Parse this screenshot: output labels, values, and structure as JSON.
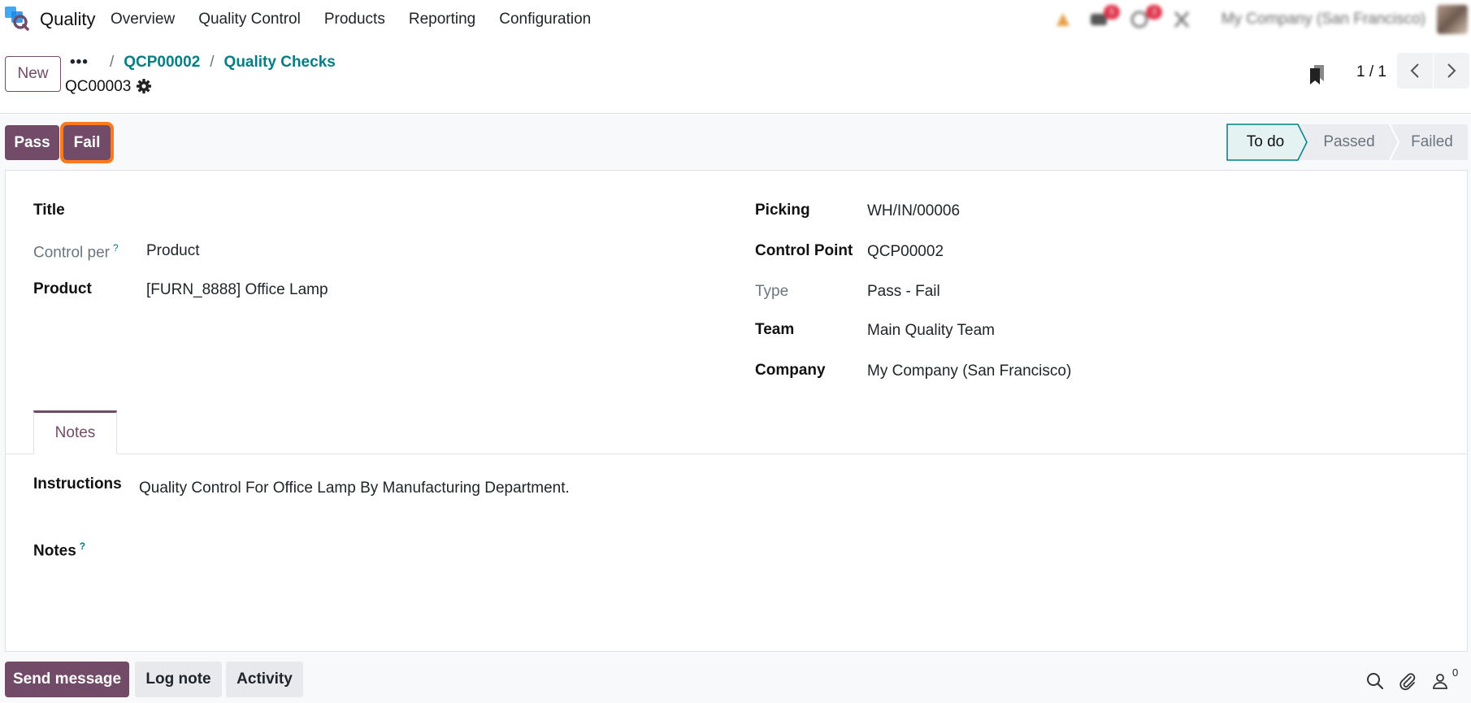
{
  "navbar": {
    "app_name": "Quality",
    "menu": [
      "Overview",
      "Quality Control",
      "Products",
      "Reporting",
      "Configuration"
    ],
    "company": "My Company (San Francisco)",
    "messages_badge": "5",
    "activities_badge": "3"
  },
  "control": {
    "new_label": "New",
    "breadcrumb": [
      "QCP00002",
      "Quality Checks"
    ],
    "record_name": "QC00003",
    "pager": "1 / 1"
  },
  "actions": {
    "pass_label": "Pass",
    "fail_label": "Fail"
  },
  "status": {
    "stages": [
      "To do",
      "Passed",
      "Failed"
    ],
    "current": "To do"
  },
  "form": {
    "left": {
      "title_label": "Title",
      "control_per_label": "Control per",
      "control_per_value": "Product",
      "product_label": "Product",
      "product_value": "[FURN_8888] Office Lamp"
    },
    "right": {
      "picking_label": "Picking",
      "picking_value": "WH/IN/00006",
      "control_point_label": "Control Point",
      "control_point_value": "QCP00002",
      "type_label": "Type",
      "type_value": "Pass - Fail",
      "team_label": "Team",
      "team_value": "Main Quality Team",
      "company_label": "Company",
      "company_value": "My Company (San Francisco)"
    },
    "tab_label": "Notes",
    "instructions_label": "Instructions",
    "instructions_value": "Quality Control For Office Lamp By Manufacturing Department.",
    "notes_label": "Notes",
    "help_mark": "?"
  },
  "chatter": {
    "send_message": "Send message",
    "log_note": "Log note",
    "activity": "Activity",
    "followers_count": "0"
  },
  "colors": {
    "brand": "#714b67",
    "link": "#017e84",
    "highlight": "#ff7a1f"
  }
}
